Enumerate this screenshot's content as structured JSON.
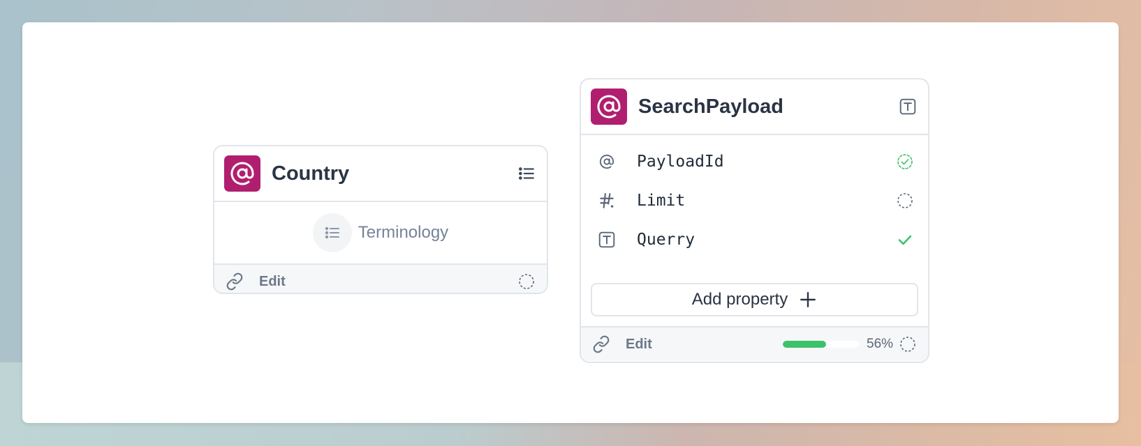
{
  "colors": {
    "badge": "#b01f6f",
    "success": "#3cc26a",
    "border": "#e1e5ea",
    "text": "#2a3444",
    "muted": "#6b7888"
  },
  "country_card": {
    "badge_icon": "at-icon",
    "title": "Country",
    "header_icon": "list-icon",
    "terminology": {
      "icon": "list-icon",
      "label": "Terminology"
    },
    "footer": {
      "link_icon": "link-icon",
      "edit_label": "Edit",
      "status_icon": "dashed-circle-icon"
    }
  },
  "search_card": {
    "badge_icon": "at-icon",
    "title": "SearchPayload",
    "header_icon": "text-type-icon",
    "properties": [
      {
        "icon": "at-icon",
        "name": "PayloadId",
        "status_icon": "dashed-check-circle-icon"
      },
      {
        "icon": "hash-icon",
        "name": "Limit",
        "status_icon": "dashed-circle-icon"
      },
      {
        "icon": "text-type-icon",
        "name": "Querry",
        "status_icon": "check-icon"
      }
    ],
    "add_property_label": "Add property",
    "footer": {
      "link_icon": "link-icon",
      "edit_label": "Edit",
      "progress": 56,
      "progress_label": "56%",
      "status_icon": "dashed-circle-icon"
    }
  }
}
